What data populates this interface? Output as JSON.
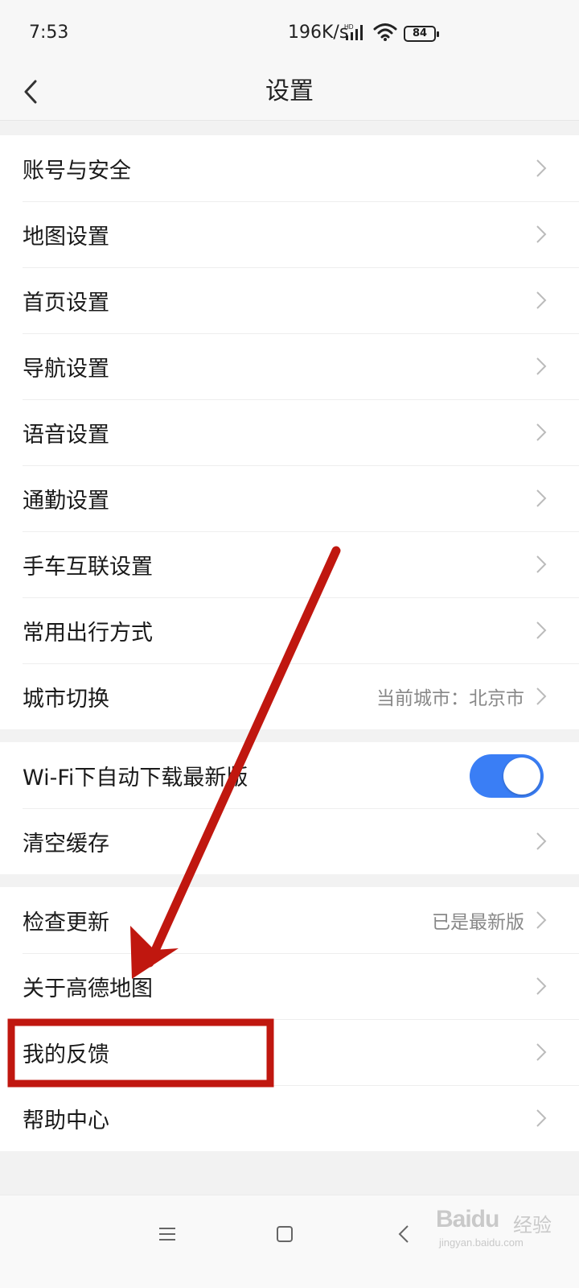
{
  "status_bar": {
    "time": "7:53",
    "speed": "196K/s",
    "network_label": "HD",
    "battery": "84"
  },
  "header": {
    "title": "设置",
    "back_icon": "chevron-left-icon"
  },
  "groups": [
    {
      "items": [
        {
          "label": "账号与安全"
        },
        {
          "label": "地图设置"
        },
        {
          "label": "首页设置"
        },
        {
          "label": "导航设置"
        },
        {
          "label": "语音设置"
        },
        {
          "label": "通勤设置"
        },
        {
          "label": "手车互联设置"
        },
        {
          "label": "常用出行方式"
        },
        {
          "label": "城市切换",
          "value": "当前城市：北京市"
        }
      ]
    },
    {
      "items": [
        {
          "label": "Wi-Fi下自动下载最新版",
          "toggle_on": true
        },
        {
          "label": "清空缓存"
        }
      ]
    },
    {
      "items": [
        {
          "label": "检查更新",
          "value": "已是最新版"
        },
        {
          "label": "关于高德地图"
        },
        {
          "label": "我的反馈"
        },
        {
          "label": "帮助中心"
        }
      ]
    }
  ],
  "system_nav": {
    "icons": [
      "menu-icon",
      "home-square-icon",
      "back-chevron-icon"
    ]
  },
  "annotation": {
    "color": "#c0170f",
    "highlighted_item": "我的反馈"
  },
  "watermark": {
    "brand": "Baidu",
    "suffix": "经验",
    "url": "jingyan.baidu.com"
  },
  "colors": {
    "toggle_on": "#3a7ef5",
    "background": "#f2f2f2"
  }
}
